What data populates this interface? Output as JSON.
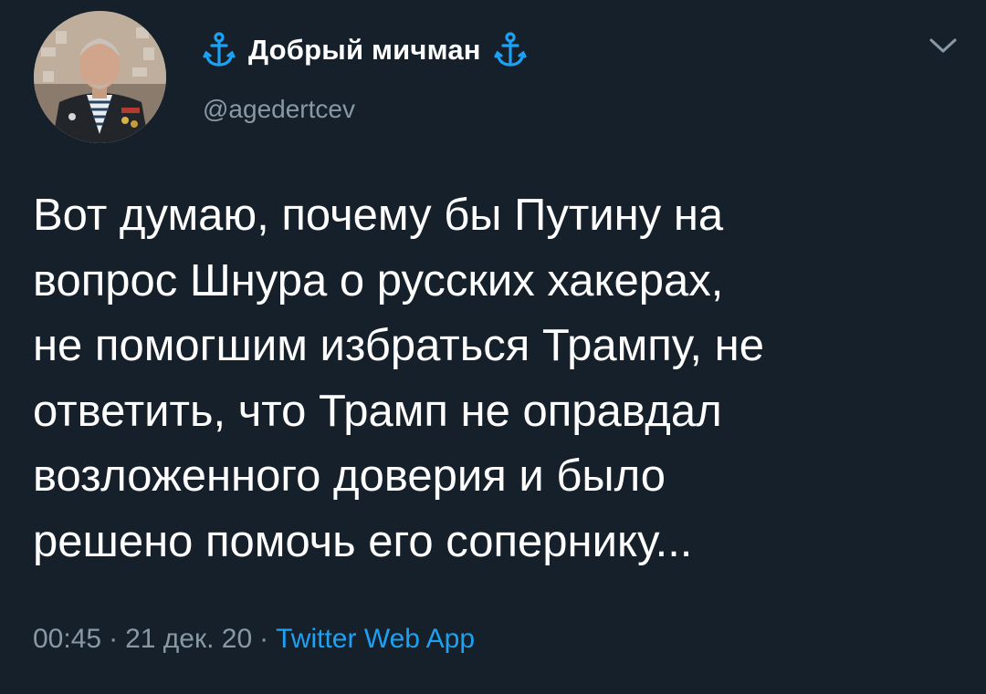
{
  "author": {
    "display_name": "Добрый мичман",
    "handle": "@agedertcev",
    "badge_icon": "anchor-icon",
    "badge_color": "#1da1f2",
    "avatar": "avatar-photo"
  },
  "menu": {
    "icon": "chevron-down-icon"
  },
  "tweet": {
    "text": "Вот думаю, почему бы Путину на\nвопрос Шнура о русских хакерах,\nне помогшим избраться Трампу, не\nответить, что Трамп не оправдал\nвозложенного доверия и было\nрешено помочь его сопернику..."
  },
  "meta": {
    "time": "00:45",
    "date": "21 дек. 20",
    "separator": "·",
    "source": "Twitter Web App"
  },
  "colors": {
    "background": "#15202b",
    "primary_text": "#ffffff",
    "secondary_text": "#8899a6",
    "accent": "#1da1f2"
  }
}
